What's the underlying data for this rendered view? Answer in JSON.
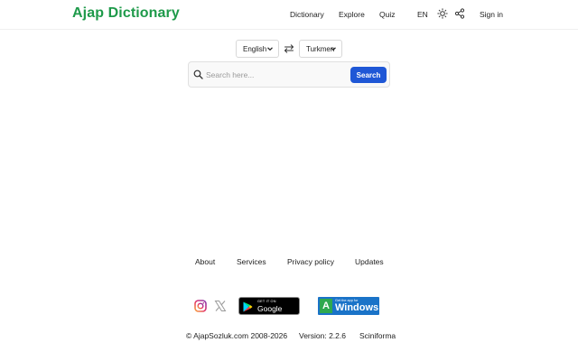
{
  "header": {
    "logo": "Ajap Dictionary",
    "nav": [
      "Dictionary",
      "Explore",
      "Quiz"
    ],
    "lang": "EN",
    "signin": "Sign in"
  },
  "translator": {
    "source_lang": "English",
    "target_lang": "Turkmen",
    "search_placeholder": "Search here...",
    "search_button": "Search"
  },
  "footer": {
    "links": [
      "About",
      "Services",
      "Privacy policy",
      "Updates"
    ],
    "google_play_small": "GET IT ON",
    "google_play_big": "Google Play",
    "windows_small": "Get the app for",
    "windows_big": "Windows",
    "copyright": "© AjapSozluk.com 2008-2026",
    "version": "Version: 2.2.6",
    "company": "Sciniforma"
  },
  "colors": {
    "brand": "#1e9a4a",
    "accent": "#1f57d6"
  },
  "icons": {
    "theme": "sun-icon",
    "share": "share-icon",
    "swap": "swap-arrows-icon",
    "search": "search-icon",
    "instagram": "instagram-icon",
    "x": "x-twitter-icon"
  }
}
